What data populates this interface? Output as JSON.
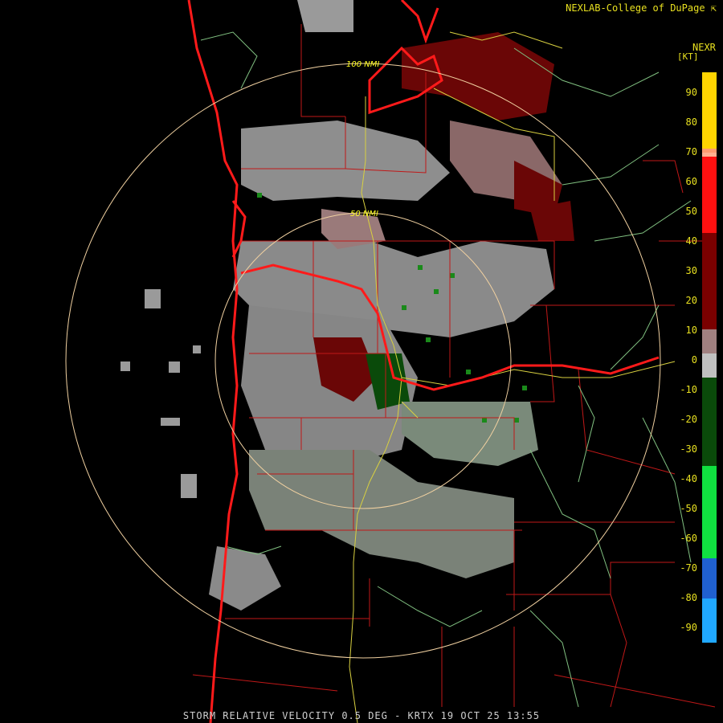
{
  "credit": "NEXLAB-College of DuPage",
  "product": "NEXR",
  "unit": "[KT]",
  "caption": "STORM RELATIVE VELOCITY 0.5 DEG - KRTX 19 OCT 25 13:55",
  "range_rings": [
    {
      "label": "50 NMI"
    },
    {
      "label": "100 NMI"
    }
  ],
  "legend": {
    "ticks": [
      "90",
      "80",
      "70",
      "60",
      "50",
      "40",
      "30",
      "20",
      "10",
      "0",
      "-10",
      "-20",
      "-30",
      "-40",
      "-50",
      "-60",
      "-70",
      "-80",
      "-90"
    ],
    "colors": {
      "top": "#ffff00",
      "orange": "#ff9a70",
      "red": "#ff1010",
      "darkred": "#7a0000",
      "gray": "#c0c0c0",
      "darkgreen": "#0a4a0a",
      "green": "#10e040",
      "blue": "#2060d0",
      "lightblue": "#20a8ff"
    }
  },
  "colors": {
    "coastline": "#ff1a1a",
    "county_lines": "#c01818",
    "highways": "#d8d040",
    "rivers": "#80c080",
    "range_ring": "#f0d0a0"
  }
}
